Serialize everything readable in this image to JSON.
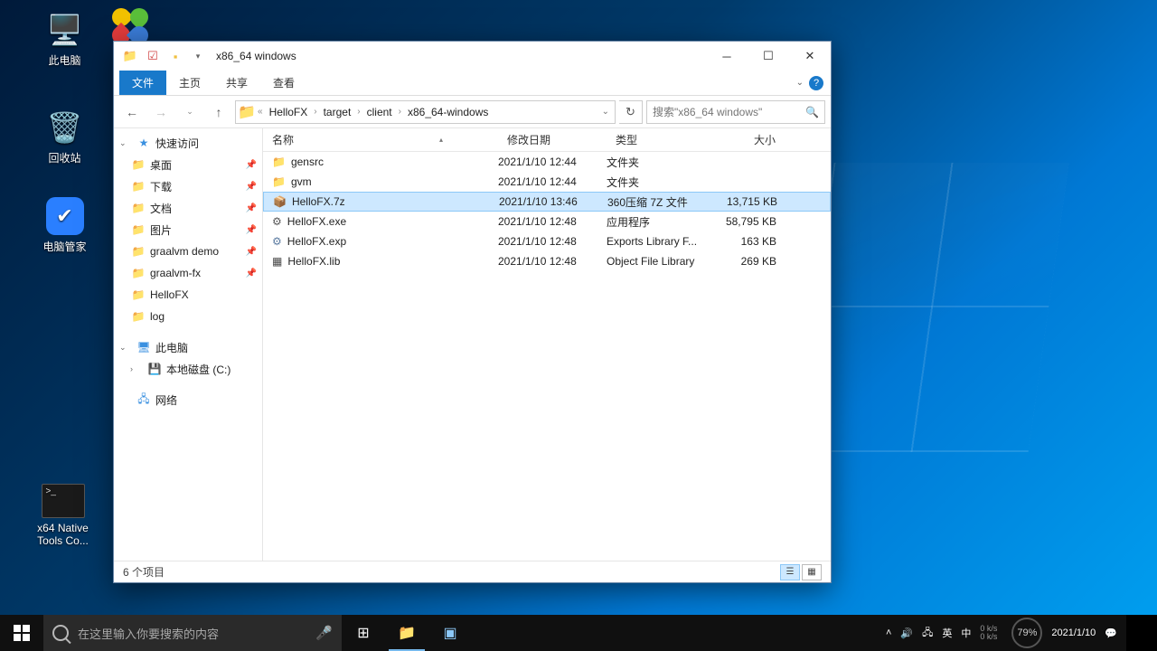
{
  "desktop_icons": {
    "pc": "此电脑",
    "bin": "回收站",
    "tencent": "电脑管家",
    "cmd": "x64 Native\nTools Co..."
  },
  "window": {
    "title": "x86_64 windows",
    "ribbon": {
      "file": "文件",
      "home": "主页",
      "share": "共享",
      "view": "查看"
    },
    "breadcrumbs": [
      "HelloFX",
      "target",
      "client",
      "x86_64-windows"
    ],
    "search_placeholder": "搜索\"x86_64 windows\"",
    "nav": {
      "quick": "快速访问",
      "desktop": "桌面",
      "downloads": "下载",
      "documents": "文档",
      "pictures": "图片",
      "graalvm_demo": "graalvm demo",
      "graalvm_fx": "graalvm-fx",
      "hellofx": "HelloFX",
      "log": "log",
      "thispc": "此电脑",
      "localdisk": "本地磁盘 (C:)",
      "network": "网络"
    },
    "columns": {
      "name": "名称",
      "date": "修改日期",
      "type": "类型",
      "size": "大小"
    },
    "files": [
      {
        "name": "gensrc",
        "date": "2021/1/10 12:44",
        "type": "文件夹",
        "size": "",
        "icon": "folder"
      },
      {
        "name": "gvm",
        "date": "2021/1/10 12:44",
        "type": "文件夹",
        "size": "",
        "icon": "folder"
      },
      {
        "name": "HelloFX.7z",
        "date": "2021/1/10 13:46",
        "type": "360压缩 7Z 文件",
        "size": "13,715 KB",
        "icon": "7z",
        "selected": true
      },
      {
        "name": "HelloFX.exe",
        "date": "2021/1/10 12:48",
        "type": "应用程序",
        "size": "58,795 KB",
        "icon": "exe"
      },
      {
        "name": "HelloFX.exp",
        "date": "2021/1/10 12:48",
        "type": "Exports Library F...",
        "size": "163 KB",
        "icon": "exp"
      },
      {
        "name": "HelloFX.lib",
        "date": "2021/1/10 12:48",
        "type": "Object File Library",
        "size": "269 KB",
        "icon": "lib"
      }
    ],
    "status": "6 个项目"
  },
  "taskbar": {
    "search_placeholder": "在这里输入你要搜索的内容",
    "net_up": "0 k/s",
    "net_dn": "0 k/s",
    "ime1": "英",
    "ime2": "中",
    "cpu": "79%",
    "time": "",
    "date": "2021/1/10"
  }
}
